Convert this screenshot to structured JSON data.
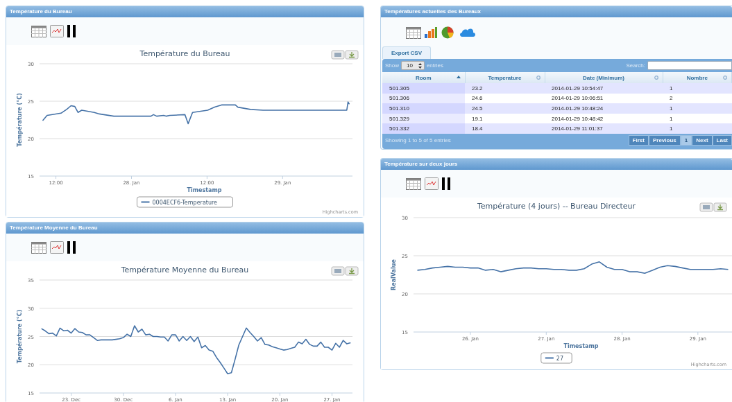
{
  "left_panels": [
    {
      "header": "Température du Bureau",
      "credit": "Highcharts.com",
      "chart_data": {
        "type": "line",
        "title": "Température du Bureau",
        "xlabel": "Timestamp",
        "ylabel": "Température (°C)",
        "x": [
          -14.1,
          -13.4,
          -11.2,
          -10.3,
          -9.6,
          -9.0,
          -8.5,
          -7.9,
          -5.9,
          -5.1,
          -2.8,
          3.1,
          3.5,
          4.0,
          5.1,
          5.5,
          6.1,
          8.5,
          9.0,
          9.7,
          12.1,
          13.2,
          14.3,
          16.5,
          16.9,
          18.9,
          20.9,
          34.2,
          34.4,
          34.6
        ],
        "series": [
          {
            "name": "0004ECF6-Temperature",
            "color": "#4572a7",
            "values": [
              22.4,
              23.1,
              23.4,
              23.9,
              24.4,
              24.3,
              23.5,
              23.8,
              23.5,
              23.3,
              23.0,
              23.0,
              23.2,
              23.0,
              23.1,
              23.0,
              23.1,
              23.2,
              22.0,
              23.5,
              23.8,
              24.2,
              24.5,
              24.5,
              24.2,
              23.9,
              23.8,
              23.8,
              24.9,
              24.6
            ]
          }
        ],
        "grid": true,
        "xlim": [
          -14.6,
          35.1
        ],
        "ylim": [
          15,
          30
        ],
        "yticks": [
          15,
          20,
          25,
          30
        ],
        "xticks": [
          {
            "value": -12,
            "label": "12:00"
          },
          {
            "value": 0,
            "label": "28. Jan"
          },
          {
            "value": 12,
            "label": "12:00"
          },
          {
            "value": 24,
            "label": "29. Jan"
          }
        ]
      }
    },
    {
      "header": "Température Moyenne du Bureau",
      "chart_data": {
        "type": "line",
        "title": "Température Moyenne du Bureau",
        "ylabel": "Température (°C)",
        "categories": [
          null,
          null,
          null,
          null,
          null,
          null,
          null,
          null,
          "23. Dec",
          null,
          null,
          null,
          null,
          null,
          null,
          null,
          null,
          null,
          null,
          null,
          null,
          null,
          "30. Dec",
          null,
          null,
          null,
          null,
          null,
          null,
          null,
          null,
          null,
          null,
          null,
          null,
          null,
          "6. Jan",
          null,
          null,
          null,
          null,
          null,
          null,
          null,
          null,
          null,
          null,
          null,
          null,
          null,
          "13. Jan",
          null,
          null,
          null,
          null,
          null,
          null,
          null,
          null,
          null,
          null,
          null,
          null,
          null,
          "20. Jan",
          null,
          null,
          null,
          null,
          null,
          null,
          null,
          null,
          null,
          null,
          null,
          null,
          null,
          "27. Jan",
          null,
          null,
          null,
          null,
          null
        ],
        "series": [
          {
            "color": "#4572a7",
            "values": [
              26.4,
              26.0,
              25.5,
              25.6,
              25.1,
              26.5,
              26.0,
              26.1,
              25.6,
              26.4,
              25.8,
              25.7,
              25.3,
              25.3,
              24.8,
              24.3,
              24.4,
              24.4,
              24.4,
              24.4,
              24.5,
              24.6,
              24.8,
              25.4,
              25.0,
              26.9,
              25.8,
              26.3,
              25.3,
              25.4,
              25.0,
              25.0,
              24.9,
              24.9,
              24.2,
              25.3,
              25.3,
              24.2,
              25.0,
              24.3,
              25.0,
              24.1,
              24.9,
              23.0,
              23.4,
              22.6,
              22.4,
              21.3,
              20.4,
              19.4,
              18.4,
              18.6,
              21.0,
              23.5,
              25.0,
              26.5,
              25.7,
              25.0,
              24.2,
              24.8,
              23.6,
              23.5,
              23.2,
              23.0,
              22.8,
              22.6,
              22.7,
              22.9,
              23.1,
              24.0,
              23.7,
              24.5,
              23.6,
              23.3,
              23.3,
              24.0,
              23.1,
              23.1,
              22.6,
              23.8,
              23.1,
              24.3,
              23.7,
              23.9
            ]
          }
        ],
        "grid": true,
        "ylim": [
          15,
          35
        ],
        "yticks": [
          15,
          20,
          25,
          30,
          35
        ]
      }
    }
  ],
  "table_panel": {
    "header": "Températures actuelles des Bureaux",
    "export_button": "Export CSV",
    "length_before": "Show",
    "length_value": "10",
    "length_after": "entries",
    "search_label": "Search:",
    "columns": [
      {
        "label": "Room",
        "sorted": true
      },
      {
        "label": "Temperature",
        "sorted": false
      },
      {
        "label": "Date (Minimum)",
        "sorted": false
      },
      {
        "label": "Nombre",
        "sorted": false
      }
    ],
    "rows": [
      [
        "501.305",
        "23.2",
        "2014-01-29 10:54:47",
        "1"
      ],
      [
        "501.306",
        "24.6",
        "2014-01-29 10:06:51",
        "2"
      ],
      [
        "501.310",
        "24.5",
        "2014-01-29 10:48:24",
        "1"
      ],
      [
        "501.329",
        "19.1",
        "2014-01-29 10:48:42",
        "1"
      ],
      [
        "501.332",
        "18.4",
        "2014-01-29 11:01:37",
        "1"
      ]
    ],
    "info": "Showing 1 to 5 of 5 entries",
    "pagination": [
      {
        "label": "First",
        "disabled": true
      },
      {
        "label": "Previous",
        "disabled": true
      },
      {
        "label": "1",
        "disabled": false
      },
      {
        "label": "Next",
        "disabled": true
      },
      {
        "label": "Last",
        "disabled": true
      }
    ]
  },
  "right_chart_panel": {
    "header": "Température sur deux jours",
    "credit": "Highcharts.com",
    "chart_data": {
      "type": "line",
      "title": "Température (4 jours) -- Bureau Directeur",
      "xlabel": "Timestamp",
      "ylabel": "RealValue",
      "categories": [
        null,
        null,
        null,
        null,
        null,
        null,
        null,
        "26. Jan",
        null,
        null,
        null,
        null,
        null,
        null,
        null,
        null,
        null,
        "27. Jan",
        null,
        null,
        null,
        null,
        null,
        null,
        null,
        null,
        null,
        "28. Jan",
        null,
        null,
        null,
        null,
        null,
        null,
        null,
        null,
        null,
        "29. Jan",
        null,
        null,
        null,
        null
      ],
      "series": [
        {
          "name": "27",
          "color": "#4572a7",
          "values": [
            23.1,
            23.2,
            23.4,
            23.5,
            23.6,
            23.5,
            23.5,
            23.4,
            23.4,
            23.1,
            23.2,
            22.9,
            23.1,
            23.3,
            23.4,
            23.4,
            23.3,
            23.3,
            23.2,
            23.2,
            23.1,
            23.1,
            23.3,
            23.9,
            24.2,
            23.5,
            23.2,
            23.2,
            22.9,
            22.9,
            22.7,
            23.1,
            23.5,
            23.7,
            23.6,
            23.4,
            23.2,
            23.2,
            23.2,
            23.2,
            23.3,
            23.2
          ]
        }
      ],
      "grid": true,
      "ylim": [
        15,
        30
      ],
      "yticks": [
        15,
        20,
        25,
        30
      ]
    }
  }
}
